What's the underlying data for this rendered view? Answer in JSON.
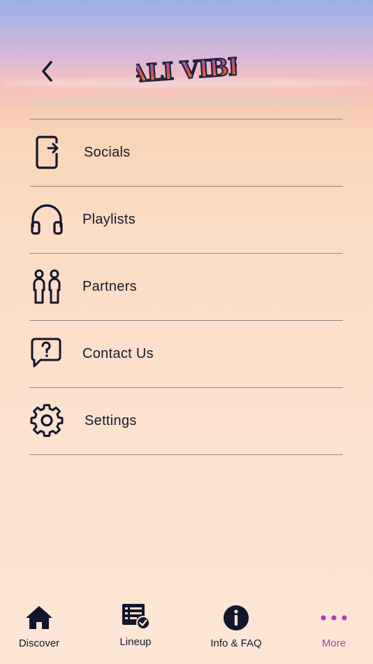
{
  "header": {
    "back_icon": "chevron-left-icon",
    "logo_text": "CALI VIBES"
  },
  "menu": {
    "items": [
      {
        "label": "Socials",
        "icon": "phone-share-icon"
      },
      {
        "label": "Playlists",
        "icon": "headphones-icon"
      },
      {
        "label": "Partners",
        "icon": "people-icon"
      },
      {
        "label": "Contact Us",
        "icon": "question-bubble-icon"
      },
      {
        "label": "Settings",
        "icon": "gear-icon"
      }
    ]
  },
  "tabbar": {
    "tabs": [
      {
        "label": "Discover",
        "icon": "home-icon",
        "active": false
      },
      {
        "label": "Lineup",
        "icon": "checklist-icon",
        "active": false
      },
      {
        "label": "Info & FAQ",
        "icon": "info-icon",
        "active": false
      },
      {
        "label": "More",
        "icon": "more-dots-icon",
        "active": true
      }
    ],
    "active_color": "#b43bb0"
  },
  "colors": {
    "text": "#161a2b",
    "divider": "#8e8a86"
  }
}
